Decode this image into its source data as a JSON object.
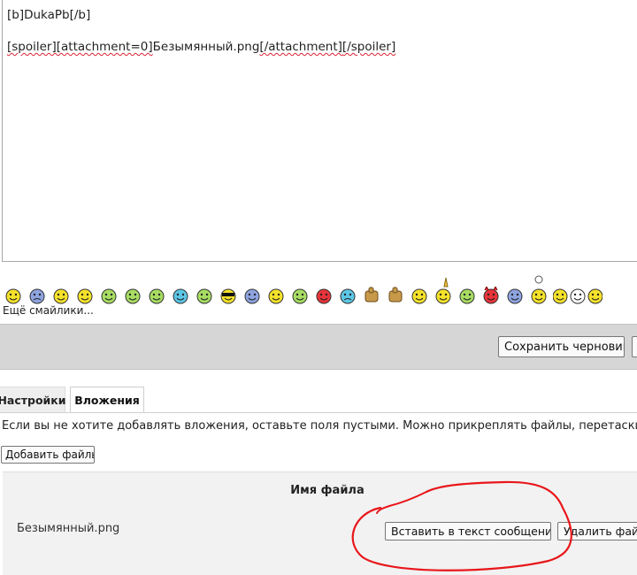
{
  "editor": {
    "line1": "[b]DukaPb[/b]",
    "line2_tag1": "[spoiler]",
    "line2_tag2": "[attachment=0]",
    "line2_file": "Безымянный.png",
    "line2_tag3": "[/attachment]",
    "line2_tag4": "[/spoiler]"
  },
  "smilies": {
    "icons": [
      "smile-icon",
      "sad-icon",
      "smile-icon",
      "smile-icon",
      "neutral-icon",
      "grin-icon",
      "grin-icon",
      "laugh-icon",
      "grimace-icon",
      "cool-icon",
      "shocked-icon",
      "rolleyes-icon",
      "confused-icon",
      "mad-icon",
      "upset-icon",
      "thumbs-up-icon",
      "thumbs-down-icon",
      "smile-icon",
      "rock-icon",
      "dizzy-icon",
      "devil-icon",
      "nerd-icon",
      "idea-icon",
      "linked-smilies-icon"
    ],
    "more_label": "Ещё смайлики..."
  },
  "toolbar": {
    "save_draft_label": "Сохранить черновик"
  },
  "tabs": [
    {
      "label": "Настройки"
    },
    {
      "label": "Вложения"
    }
  ],
  "attachments": {
    "hint": "Если вы не хотите добавлять вложения, оставьте поля пустыми. Можно прикреплять файлы, перетаскивая",
    "add_files_label": "Добавить файлы",
    "column_header": "Имя файла",
    "files": [
      {
        "name": "Безымянный.png",
        "insert_label": "Вставить в текст сообщения",
        "delete_label": "Удалить файл"
      }
    ]
  },
  "colors": {
    "smiley_yellow": "#f5e22a",
    "annotation_red": "#e8171b",
    "toolbar_gray": "#d6d6d6"
  }
}
